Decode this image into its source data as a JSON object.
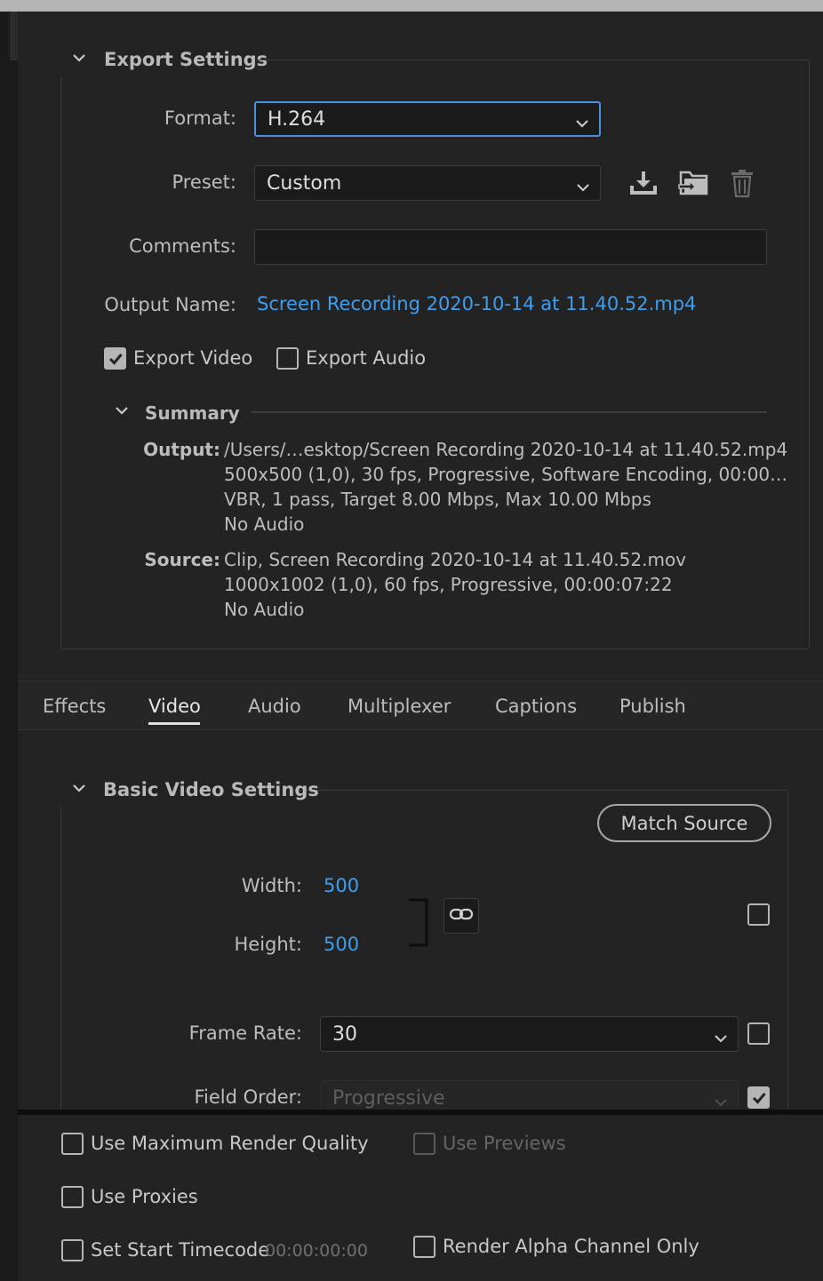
{
  "export_settings": {
    "title": "Export Settings",
    "format_label": "Format:",
    "format_value": "H.264",
    "preset_label": "Preset:",
    "preset_value": "Custom",
    "comments_label": "Comments:",
    "comments_value": "",
    "output_name_label": "Output Name:",
    "output_name_value": "Screen Recording 2020-10-14 at 11.40.52.mp4",
    "export_video_label": "Export Video",
    "export_video_checked": true,
    "export_audio_label": "Export Audio",
    "export_audio_checked": false,
    "preset_icons": [
      "save-preset-icon",
      "import-preset-icon",
      "delete-preset-icon"
    ]
  },
  "summary": {
    "title": "Summary",
    "output_key": "Output:",
    "output_lines": [
      "/Users/…esktop/Screen Recording 2020-10-14 at 11.40.52.mp4",
      "500x500 (1,0), 30 fps, Progressive, Software Encoding, 00:00…",
      "VBR, 1 pass, Target 8.00 Mbps, Max 10.00 Mbps",
      "No Audio"
    ],
    "source_key": "Source:",
    "source_lines": [
      "Clip, Screen Recording 2020-10-14 at 11.40.52.mov",
      "1000x1002 (1,0), 60 fps, Progressive, 00:00:07:22",
      "No Audio"
    ]
  },
  "tabs": [
    {
      "label": "Effects",
      "active": false
    },
    {
      "label": "Video",
      "active": true
    },
    {
      "label": "Audio",
      "active": false
    },
    {
      "label": "Multiplexer",
      "active": false
    },
    {
      "label": "Captions",
      "active": false
    },
    {
      "label": "Publish",
      "active": false
    }
  ],
  "basic_video": {
    "title": "Basic Video Settings",
    "match_source_label": "Match Source",
    "width_label": "Width:",
    "width_value": "500",
    "height_label": "Height:",
    "height_value": "500",
    "frame_rate_label": "Frame Rate:",
    "frame_rate_value": "30",
    "field_order_label": "Field Order:",
    "field_order_value": "Progressive"
  },
  "bottom_options": {
    "max_render_quality_label": "Use Maximum Render Quality",
    "use_previews_label": "Use Previews",
    "use_proxies_label": "Use Proxies",
    "set_start_timecode_label": "Set Start Timecode",
    "timecode_value": "00:00:00:00",
    "render_alpha_label": "Render Alpha Channel Only"
  },
  "colors": {
    "accent": "#3d9ef0",
    "focus_border": "#4a90e2",
    "background": "#232323"
  }
}
